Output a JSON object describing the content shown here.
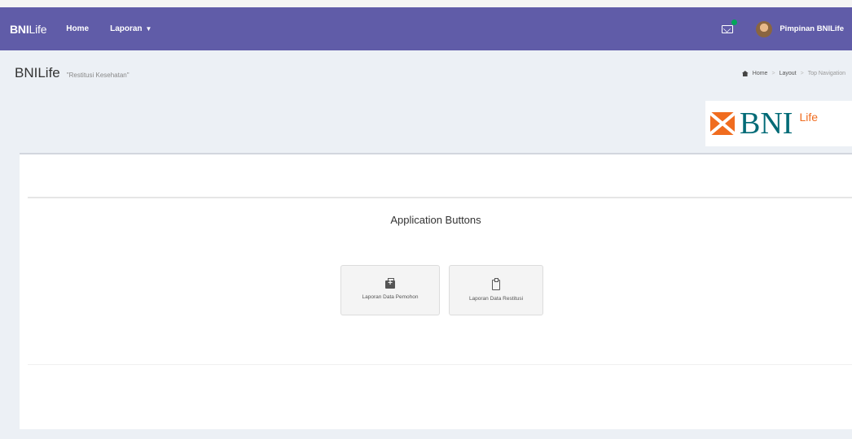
{
  "navbar": {
    "brand_bold": "BNI",
    "brand_rest": "Life",
    "links": [
      {
        "label": "Home"
      },
      {
        "label": "Laporan"
      }
    ],
    "user_name": "Pimpinan BNILife",
    "accent_color": "#605ca8"
  },
  "header": {
    "title": "BNILife",
    "subtitle": "\"Restitusi Kesehatan\"",
    "breadcrumb": [
      "Home",
      "Layout",
      "Top Navigation"
    ]
  },
  "logo": {
    "text": "BNI",
    "suffix": "Life"
  },
  "panel": {
    "section_title": "Application Buttons",
    "buttons": [
      {
        "label": "Laporan Data Pemohon",
        "icon": "medkit-icon"
      },
      {
        "label": "Laporan Data Restitusi",
        "icon": "clipboard-icon"
      }
    ]
  }
}
